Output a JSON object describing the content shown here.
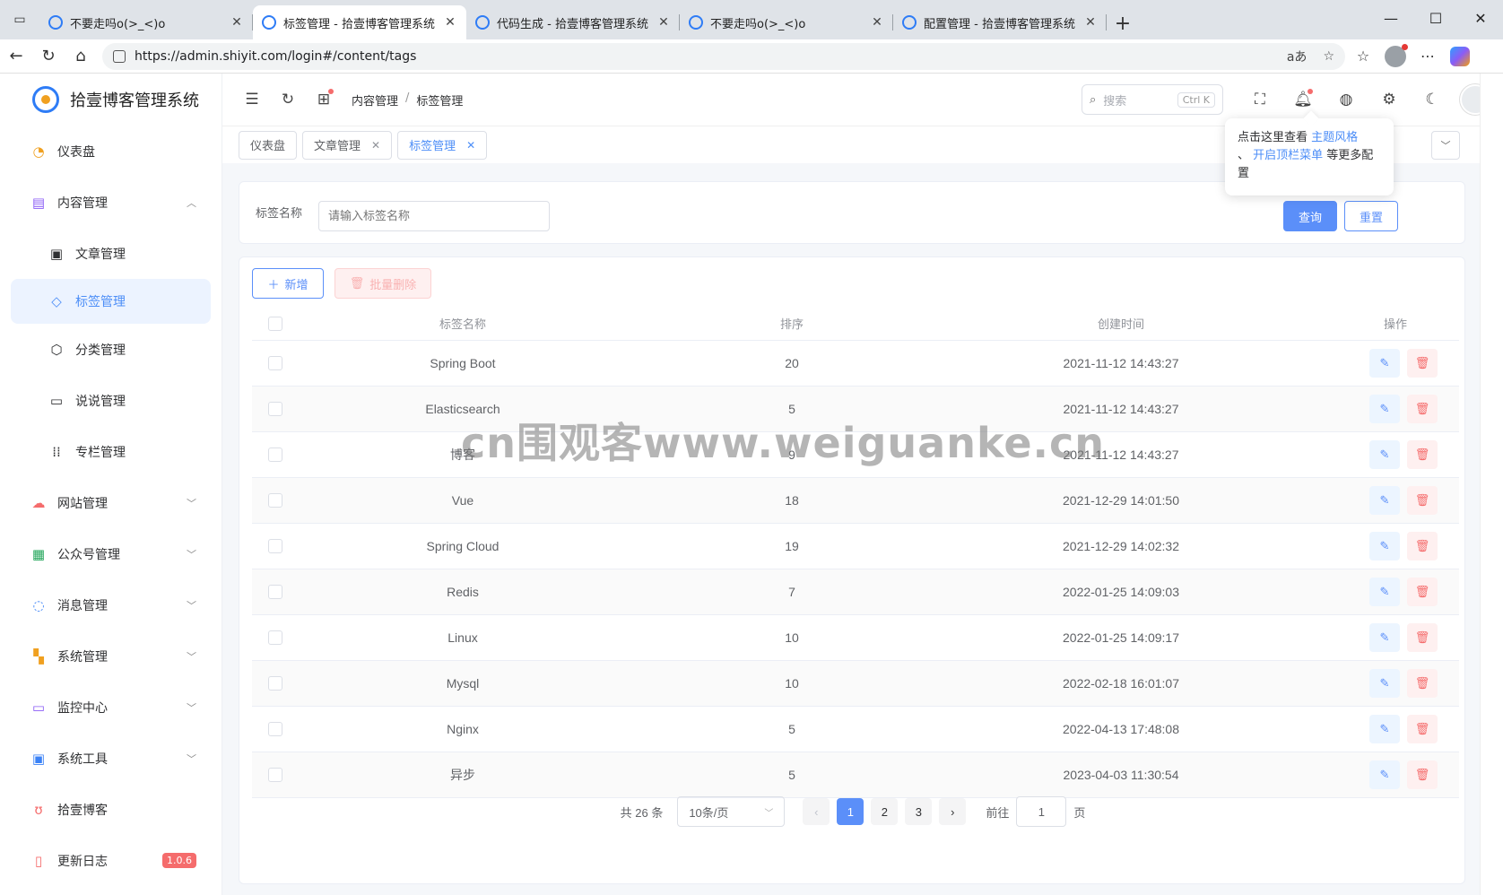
{
  "browser": {
    "tabs": [
      {
        "title": "不要走吗o(>_<)o",
        "active": false
      },
      {
        "title": "标签管理 - 拾壹博客管理系统",
        "active": true
      },
      {
        "title": "代码生成 - 拾壹博客管理系统",
        "active": false
      },
      {
        "title": "不要走吗o(>_<)o",
        "active": false
      },
      {
        "title": "配置管理 - 拾壹博客管理系统",
        "active": false
      }
    ],
    "url": "https://admin.shiyit.com/login#/content/tags"
  },
  "app": {
    "title": "拾壹博客管理系统"
  },
  "sidebar": {
    "items": [
      {
        "label": "仪表盘",
        "icon": "dashboard-icon"
      },
      {
        "label": "内容管理",
        "icon": "content-icon"
      },
      {
        "label": "文章管理",
        "icon": "article-icon"
      },
      {
        "label": "标签管理",
        "icon": "tag-icon"
      },
      {
        "label": "分类管理",
        "icon": "category-icon"
      },
      {
        "label": "说说管理",
        "icon": "talk-icon"
      },
      {
        "label": "专栏管理",
        "icon": "column-icon"
      },
      {
        "label": "网站管理",
        "icon": "cloud-icon"
      },
      {
        "label": "公众号管理",
        "icon": "wechat-icon"
      },
      {
        "label": "消息管理",
        "icon": "message-icon"
      },
      {
        "label": "系统管理",
        "icon": "system-icon"
      },
      {
        "label": "监控中心",
        "icon": "monitor-icon"
      },
      {
        "label": "系统工具",
        "icon": "tools-icon"
      },
      {
        "label": "拾壹博客",
        "icon": "blog-icon"
      },
      {
        "label": "更新日志",
        "icon": "log-icon"
      }
    ],
    "version": "1.0.6"
  },
  "header": {
    "breadcrumb": [
      "内容管理",
      "标签管理"
    ],
    "search_placeholder": "搜索",
    "search_shortcut": "Ctrl K"
  },
  "tagsbar": {
    "tabs": [
      "仪表盘",
      "文章管理",
      "标签管理"
    ]
  },
  "search_form": {
    "label": "标签名称",
    "placeholder": "请输入标签名称",
    "query_label": "查询",
    "reset_label": "重置"
  },
  "toolbar": {
    "add_label": "新增",
    "batch_delete_label": "批量删除"
  },
  "table": {
    "columns": [
      "标签名称",
      "排序",
      "创建时间",
      "操作"
    ],
    "rows": [
      {
        "name": "Spring Boot",
        "sort": "20",
        "created": "2021-11-12 14:43:27"
      },
      {
        "name": "Elasticsearch",
        "sort": "5",
        "created": "2021-11-12 14:43:27"
      },
      {
        "name": "博客",
        "sort": "9",
        "created": "2021-11-12 14:43:27"
      },
      {
        "name": "Vue",
        "sort": "18",
        "created": "2021-12-29 14:01:50"
      },
      {
        "name": "Spring Cloud",
        "sort": "19",
        "created": "2021-12-29 14:02:32"
      },
      {
        "name": "Redis",
        "sort": "7",
        "created": "2022-01-25 14:09:03"
      },
      {
        "name": "Linux",
        "sort": "10",
        "created": "2022-01-25 14:09:17"
      },
      {
        "name": "Mysql",
        "sort": "10",
        "created": "2022-02-18 16:01:07"
      },
      {
        "name": "Nginx",
        "sort": "5",
        "created": "2022-04-13 17:48:08"
      },
      {
        "name": "异步",
        "sort": "5",
        "created": "2023-04-03 11:30:54"
      }
    ]
  },
  "pagination": {
    "total_text": "共 26 条",
    "page_size": "10条/页",
    "pages": [
      "1",
      "2",
      "3"
    ],
    "current": "1",
    "goto_prefix": "前往",
    "goto_value": "1",
    "goto_suffix": "页"
  },
  "popover": {
    "text1": "点击这里查看 ",
    "link1": "主题风格",
    "text2": "、",
    "link2": "开启顶栏菜单",
    "text3": " 等更多配置"
  },
  "watermark": "cn围观客www.weiguanke.cn",
  "colors": {
    "primary": "#5b8ff9",
    "danger": "#f56c6c",
    "menu_active_bg": "#ecf3ff"
  }
}
